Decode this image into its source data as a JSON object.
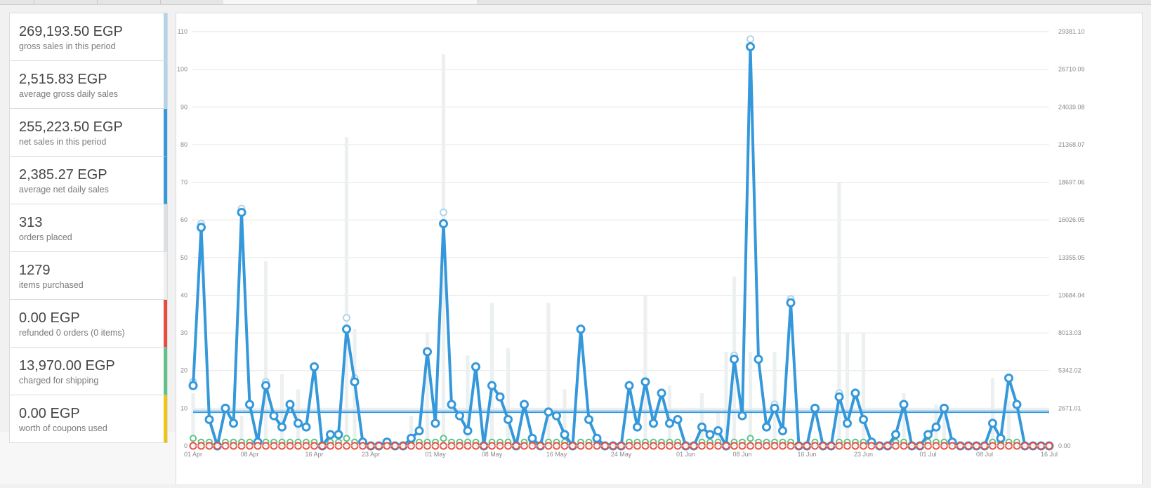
{
  "legend": [
    {
      "value": "269,193.50 EGP",
      "label": "gross sales in this period",
      "color": "#b1d4ea"
    },
    {
      "value": "2,515.83 EGP",
      "label": "average gross daily sales",
      "color": "#b1d4ea"
    },
    {
      "value": "255,223.50 EGP",
      "label": "net sales in this period",
      "color": "#3498db"
    },
    {
      "value": "2,385.27 EGP",
      "label": "average net daily sales",
      "color": "#3498db"
    },
    {
      "value": "313",
      "label": "orders placed",
      "color": "#dbe1e3"
    },
    {
      "value": "1279",
      "label": "items purchased",
      "color": "#ecf0f1"
    },
    {
      "value": "0.00 EGP",
      "label": "refunded 0 orders (0 items)",
      "color": "#e74c3c"
    },
    {
      "value": "13,970.00 EGP",
      "label": "charged for shipping",
      "color": "#5cc488"
    },
    {
      "value": "0.00 EGP",
      "label": "worth of coupons used",
      "color": "#f1c40f"
    }
  ],
  "chart_data": {
    "type": "line",
    "x_tick_labels": [
      "01 Apr",
      "08 Apr",
      "16 Apr",
      "23 Apr",
      "01 May",
      "08 May",
      "16 May",
      "24 May",
      "01 Jun",
      "08 Jun",
      "16 Jun",
      "23 Jun",
      "01 Jul",
      "08 Jul",
      "16 Jul"
    ],
    "y_left_ticks": [
      "0",
      "10",
      "20",
      "30",
      "40",
      "50",
      "60",
      "70",
      "80",
      "90",
      "100",
      "110"
    ],
    "y_right_ticks": [
      "0.00",
      "2671.01",
      "5342.02",
      "8013.03",
      "10684.04",
      "13355.05",
      "16026.05",
      "18697.06",
      "21368.07",
      "24039.08",
      "26710.09",
      "29381.10"
    ],
    "ylim_left": [
      0,
      110
    ],
    "ylim_right": [
      0,
      29381.1
    ],
    "series": [
      {
        "name": "net sales in this period",
        "color": "#3498db",
        "values": [
          16,
          58,
          7,
          0,
          10,
          6,
          62,
          11,
          1,
          16,
          8,
          5,
          11,
          6,
          5,
          21,
          0,
          3,
          3,
          31,
          17,
          1,
          0,
          0,
          1,
          0,
          0,
          2,
          4,
          25,
          6,
          59,
          11,
          8,
          4,
          21,
          0,
          16,
          13,
          7,
          0,
          11,
          2,
          0,
          9,
          8,
          3,
          0,
          31,
          7,
          2,
          0,
          0,
          0,
          16,
          5,
          17,
          6,
          14,
          6,
          7,
          0,
          0,
          5,
          3,
          4,
          0,
          23,
          8,
          106,
          23,
          5,
          10,
          4,
          38,
          0,
          0,
          10,
          0,
          0,
          13,
          6,
          14,
          7,
          1,
          0,
          0,
          3,
          11,
          0,
          0,
          3,
          5,
          10,
          1,
          0,
          0,
          0,
          0,
          6,
          2,
          18,
          11,
          0,
          0,
          0,
          0
        ]
      },
      {
        "name": "gross sales in this period",
        "color": "#b1d4ea",
        "values": [
          17,
          59,
          7,
          0,
          10,
          6,
          63,
          11,
          1,
          17,
          8,
          5,
          11,
          6,
          5,
          21,
          0,
          3,
          3,
          34,
          18,
          1,
          0,
          0,
          1,
          0,
          0,
          2,
          4,
          25,
          6,
          62,
          11,
          8,
          4,
          21,
          0,
          16,
          13,
          7,
          0,
          11,
          2,
          0,
          9,
          8,
          3,
          0,
          31,
          7,
          2,
          0,
          0,
          0,
          16,
          5,
          17,
          6,
          14,
          6,
          7,
          0,
          0,
          5,
          3,
          4,
          0,
          24,
          8,
          108,
          23,
          5,
          11,
          4,
          39,
          0,
          0,
          10,
          0,
          0,
          14,
          6,
          14,
          7,
          1,
          0,
          0,
          3,
          11,
          0,
          0,
          3,
          5,
          10,
          1,
          0,
          0,
          0,
          0,
          6,
          2,
          18,
          11,
          0,
          0,
          0,
          0
        ]
      },
      {
        "name": "charged for shipping",
        "color": "#5cc488",
        "values": [
          2,
          1,
          1,
          0,
          1,
          1,
          1,
          1,
          1,
          1,
          1,
          1,
          1,
          1,
          1,
          1,
          0,
          1,
          1,
          2,
          1,
          1,
          0,
          0,
          0,
          0,
          0,
          1,
          1,
          1,
          1,
          2,
          1,
          1,
          1,
          1,
          0,
          1,
          1,
          1,
          0,
          1,
          1,
          0,
          1,
          1,
          1,
          0,
          1,
          1,
          1,
          0,
          0,
          0,
          1,
          1,
          1,
          1,
          1,
          1,
          1,
          0,
          0,
          1,
          1,
          1,
          0,
          1,
          1,
          2,
          1,
          1,
          1,
          1,
          1,
          0,
          0,
          1,
          0,
          0,
          1,
          1,
          1,
          1,
          1,
          0,
          0,
          1,
          1,
          0,
          0,
          1,
          1,
          1,
          1,
          0,
          0,
          0,
          0,
          1,
          1,
          1,
          1,
          0,
          0,
          0,
          0
        ]
      },
      {
        "name": "refunded 0 orders (0 items)",
        "color": "#e74c3c",
        "values": [
          0,
          0,
          0,
          0,
          0,
          0,
          0,
          0,
          0,
          0,
          0,
          0,
          0,
          0,
          0,
          0,
          0,
          0,
          0,
          0,
          0,
          0,
          0,
          0,
          0,
          0,
          0,
          0,
          0,
          0,
          0,
          0,
          0,
          0,
          0,
          0,
          0,
          0,
          0,
          0,
          0,
          0,
          0,
          0,
          0,
          0,
          0,
          0,
          0,
          0,
          0,
          0,
          0,
          0,
          0,
          0,
          0,
          0,
          0,
          0,
          0,
          0,
          0,
          0,
          0,
          0,
          0,
          0,
          0,
          0,
          0,
          0,
          0,
          0,
          0,
          0,
          0,
          0,
          0,
          0,
          0,
          0,
          0,
          0,
          0,
          0,
          0,
          0,
          0,
          0,
          0,
          0,
          0,
          0,
          0,
          0,
          0,
          0,
          0,
          0,
          0,
          0,
          0,
          0,
          0,
          0,
          0
        ]
      },
      {
        "name": "items purchased",
        "color": "#ecf0f1",
        "type": "bar",
        "values": [
          14,
          0,
          0,
          0,
          0,
          0,
          8,
          0,
          0,
          49,
          0,
          19,
          0,
          15,
          0,
          0,
          0,
          0,
          0,
          82,
          31,
          0,
          0,
          0,
          0,
          0,
          0,
          8,
          0,
          30,
          0,
          104,
          0,
          0,
          24,
          0,
          0,
          38,
          0,
          26,
          0,
          0,
          0,
          0,
          38,
          0,
          15,
          0,
          0,
          0,
          0,
          0,
          0,
          0,
          0,
          0,
          40,
          0,
          0,
          16,
          0,
          0,
          0,
          14,
          0,
          9,
          25,
          45,
          0,
          25,
          0,
          0,
          25,
          0,
          0,
          0,
          0,
          0,
          0,
          0,
          70,
          30,
          0,
          30,
          0,
          0,
          0,
          0,
          14,
          0,
          0,
          0,
          11,
          8,
          0,
          0,
          0,
          0,
          0,
          18,
          0,
          12,
          0,
          0,
          0,
          0,
          0
        ]
      }
    ],
    "averages": [
      {
        "name": "average gross daily sales",
        "value": 2515.83,
        "color": "#b1d4ea"
      },
      {
        "name": "average net daily sales",
        "value": 2385.27,
        "color": "#3498db"
      }
    ]
  }
}
